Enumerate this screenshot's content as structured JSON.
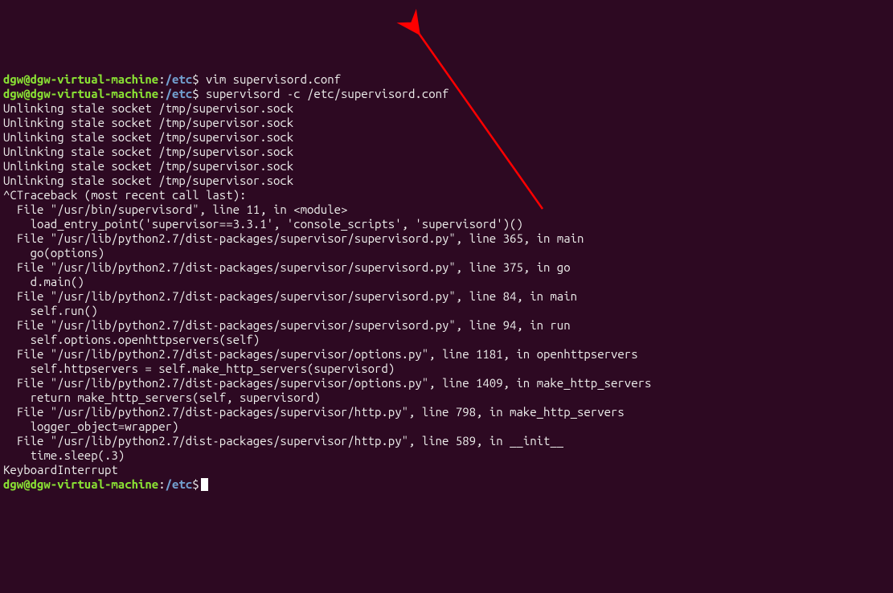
{
  "prompt": {
    "user": "dgw@dgw-virtual-machine",
    "sep": ":",
    "path": "/etc",
    "dollar": "$"
  },
  "cmd": "supervisord -c /etc/supervisord.conf",
  "truncated_top": "dgw@dgw-virtual-machine:/etc$ vim supervisord.conf",
  "unlink": "Unlinking stale socket /tmp/supervisor.sock",
  "traceback": {
    "head": "^CTraceback (most recent call last):",
    "t1a": "  File \"/usr/bin/supervisord\", line 11, in <module>",
    "t1b": "    load_entry_point('supervisor==3.3.1', 'console_scripts', 'supervisord')()",
    "t2a": "  File \"/usr/lib/python2.7/dist-packages/supervisor/supervisord.py\", line 365, in main",
    "t2b": "    go(options)",
    "t3a": "  File \"/usr/lib/python2.7/dist-packages/supervisor/supervisord.py\", line 375, in go",
    "t3b": "    d.main()",
    "t4a": "  File \"/usr/lib/python2.7/dist-packages/supervisor/supervisord.py\", line 84, in main",
    "t4b": "    self.run()",
    "t5a": "  File \"/usr/lib/python2.7/dist-packages/supervisor/supervisord.py\", line 94, in run",
    "t5b": "    self.options.openhttpservers(self)",
    "t6a": "  File \"/usr/lib/python2.7/dist-packages/supervisor/options.py\", line 1181, in openhttpservers",
    "t6b": "    self.httpservers = self.make_http_servers(supervisord)",
    "t7a": "  File \"/usr/lib/python2.7/dist-packages/supervisor/options.py\", line 1409, in make_http_servers",
    "t7b": "    return make_http_servers(self, supervisord)",
    "t8a": "  File \"/usr/lib/python2.7/dist-packages/supervisor/http.py\", line 798, in make_http_servers",
    "t8b": "    logger_object=wrapper)",
    "t9a": "  File \"/usr/lib/python2.7/dist-packages/supervisor/http.py\", line 589, in __init__",
    "t9b": "    time.sleep(.3)",
    "ki": "KeyboardInterrupt"
  }
}
